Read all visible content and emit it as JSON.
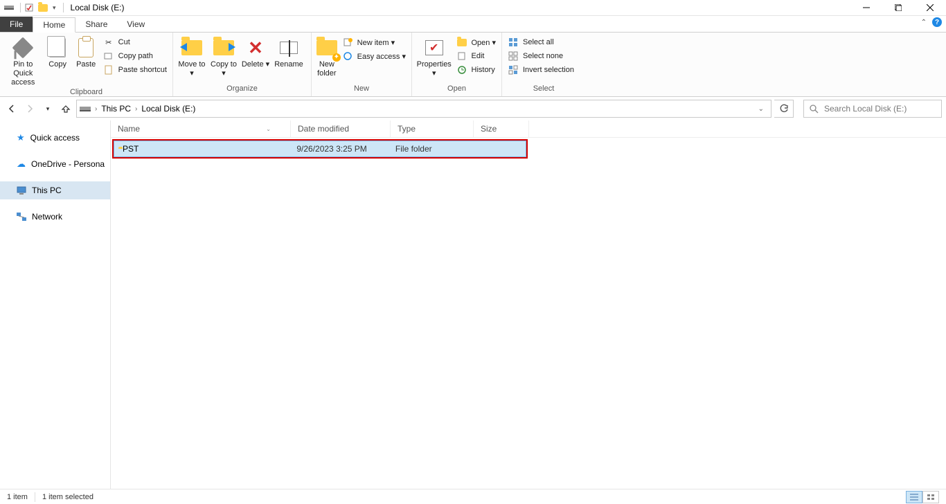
{
  "window": {
    "title": "Local Disk (E:)"
  },
  "tabs": {
    "file": "File",
    "home": "Home",
    "share": "Share",
    "view": "View"
  },
  "ribbon": {
    "clipboard": {
      "pin": "Pin to Quick access",
      "copy": "Copy",
      "paste": "Paste",
      "cut": "Cut",
      "copy_path": "Copy path",
      "paste_shortcut": "Paste shortcut",
      "group": "Clipboard"
    },
    "organize": {
      "move_to": "Move to",
      "copy_to": "Copy to",
      "delete": "Delete",
      "rename": "Rename",
      "group": "Organize"
    },
    "new": {
      "new_folder": "New folder",
      "new_item": "New item",
      "easy_access": "Easy access",
      "group": "New"
    },
    "open": {
      "properties": "Properties",
      "open": "Open",
      "edit": "Edit",
      "history": "History",
      "group": "Open"
    },
    "select": {
      "select_all": "Select all",
      "select_none": "Select none",
      "invert": "Invert selection",
      "group": "Select"
    }
  },
  "breadcrumb": {
    "root": "This PC",
    "leaf": "Local Disk (E:)"
  },
  "search": {
    "placeholder": "Search Local Disk (E:)"
  },
  "nav": {
    "quick_access": "Quick access",
    "onedrive": "OneDrive - Persona",
    "this_pc": "This PC",
    "network": "Network"
  },
  "columns": {
    "name": "Name",
    "date": "Date modified",
    "type": "Type",
    "size": "Size"
  },
  "rows": [
    {
      "name": "PST",
      "date": "9/26/2023 3:25 PM",
      "type": "File folder",
      "size": ""
    }
  ],
  "status": {
    "count": "1 item",
    "selected": "1 item selected"
  }
}
